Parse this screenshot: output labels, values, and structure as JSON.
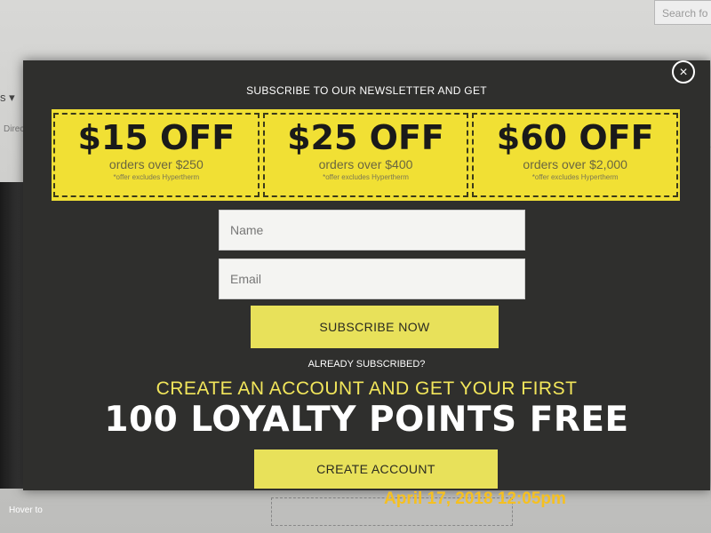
{
  "background": {
    "search_placeholder": "Search fo",
    "nav_fragment": "s ▾",
    "nav_sub_fragment": "Direc",
    "letter_fragment": "s",
    "hover_text": "Hover to"
  },
  "modal": {
    "close_glyph": "×",
    "headline": "SUBSCRIBE TO OUR NEWSLETTER AND GET",
    "offers": [
      {
        "amount": "$15 OFF",
        "condition": "orders over $250",
        "note": "*offer excludes Hypertherm"
      },
      {
        "amount": "$25 OFF",
        "condition": "orders over $400",
        "note": "*offer excludes Hypertherm"
      },
      {
        "amount": "$60 OFF",
        "condition": "orders over $2,000",
        "note": "*offer excludes Hypertherm"
      }
    ],
    "name_placeholder": "Name",
    "email_placeholder": "Email",
    "subscribe_label": "SUBSCRIBE NOW",
    "already_subscribed": "ALREADY SUBSCRIBED?",
    "create_account_line": "CREATE AN ACCOUNT AND GET YOUR FIRST",
    "points_line": "100 LOYALTY POINTS FREE",
    "create_account_label": "CREATE ACCOUNT"
  },
  "photo_timestamp": "April 17, 2018 12:05pm",
  "colors": {
    "modal_bg": "#2f2f2d",
    "accent_yellow": "#f1e034",
    "button_yellow": "#e8e15a",
    "timestamp": "#f5c021"
  }
}
